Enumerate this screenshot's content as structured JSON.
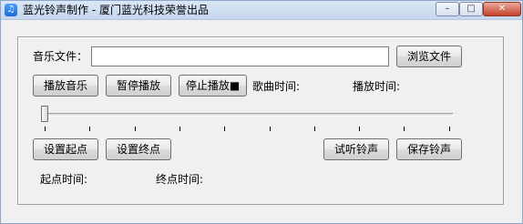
{
  "window": {
    "title": "蓝光铃声制作 - 厦门蓝光科技荣誉出品",
    "app_icon": "music-note-icon",
    "controls": {
      "minimize": "–",
      "maximize": "□",
      "close": "✕"
    }
  },
  "music_file": {
    "label": "音乐文件：",
    "value": "",
    "browse_label": "浏览文件"
  },
  "playback": {
    "play_label": "播放音乐",
    "pause_label": "暂停播放",
    "stop_label": "停止播放■",
    "song_time_label": "歌曲时间:",
    "play_time_label": "播放时间:"
  },
  "slider": {
    "position": 0
  },
  "range": {
    "set_start_label": "设置起点",
    "set_end_label": "设置终点",
    "start_time_label": "起点时间:",
    "end_time_label": "终点时间:"
  },
  "ringtone": {
    "preview_label": "试听铃声",
    "save_label": "保存铃声"
  }
}
